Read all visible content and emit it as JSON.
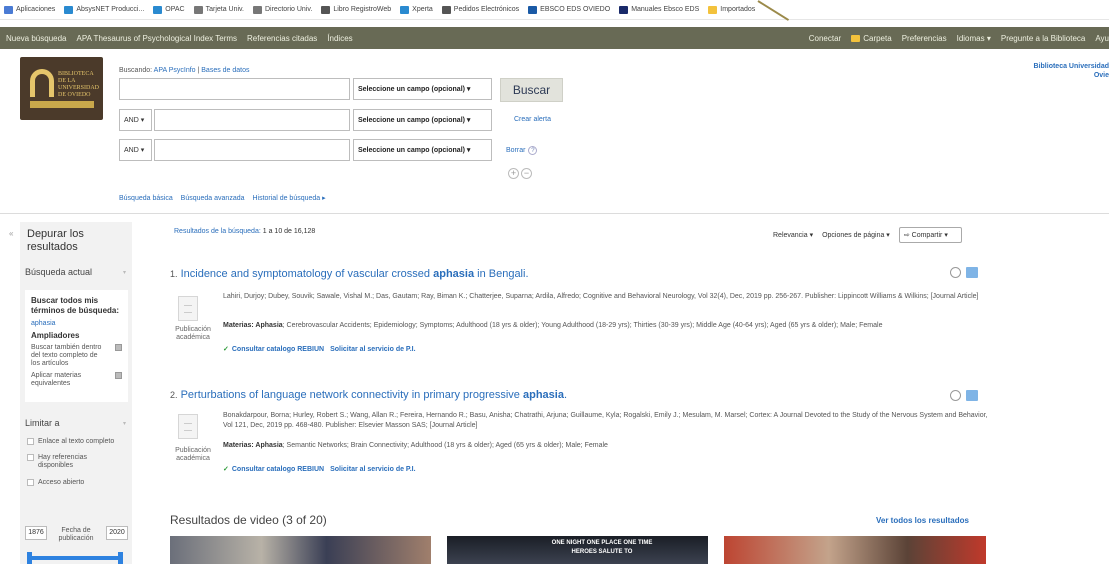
{
  "bookmarks": [
    {
      "label": "Aplicaciones",
      "icon": "apps-grid-icon",
      "color": "#4a7bd4"
    },
    {
      "label": "AbsysNET Producci...",
      "icon": "absysnet-icon",
      "color": "#2a8ad0"
    },
    {
      "label": "OPAC",
      "icon": "opac-icon",
      "color": "#2a8ad0"
    },
    {
      "label": "Tarjeta Univ.",
      "icon": "university-icon",
      "color": "#777"
    },
    {
      "label": "Directorio Univ.",
      "icon": "university-icon",
      "color": "#777"
    },
    {
      "label": "Libro RegistroWeb",
      "icon": "globe-icon",
      "color": "#555"
    },
    {
      "label": "Xperta",
      "icon": "xperta-icon",
      "color": "#2a8ad0"
    },
    {
      "label": "Pedidos Electrónicos",
      "icon": "globe-icon",
      "color": "#555"
    },
    {
      "label": "EBSCO EDS OVIEDO",
      "icon": "ebsco-icon",
      "color": "#1a5aa6"
    },
    {
      "label": "Manuales Ebsco EDS",
      "icon": "manual-icon",
      "color": "#1a2a6a"
    },
    {
      "label": "Importados",
      "icon": "folder-icon",
      "color": "#f3c23c"
    }
  ],
  "nav": {
    "left": [
      "Nueva búsqueda",
      "APA Thesaurus of Psychological Index Terms",
      "Referencias citadas",
      "Índices"
    ],
    "right": {
      "connect": "Conectar",
      "folder": "Carpeta",
      "prefs": "Preferencias",
      "lang": "Idiomas ▾",
      "ask": "Pregunte a la Biblioteca",
      "help": "Ayu"
    }
  },
  "logo": {
    "text": "BIBLIOTECA DE LA UNIVERSIDAD DE OVIEDO"
  },
  "search": {
    "searching_label": "Buscando:",
    "database": "APA PsycInfo",
    "databases_link": "Bases de datos",
    "field_placeholder": "Seleccione un campo (opcional) ▾",
    "operator": "AND ▾",
    "search_button": "Buscar",
    "create_alert": "Crear alerta",
    "clear": "Borrar",
    "links": [
      "Búsqueda básica",
      "Búsqueda avanzada",
      "Historial de búsqueda ▸"
    ]
  },
  "institution": {
    "line1": "Biblioteca Universidad",
    "line2": "Ovie"
  },
  "sidebar": {
    "title": "Depurar los resultados",
    "current": "Búsqueda actual",
    "find_all": "Buscar todos mis términos de búsqueda:",
    "term": "aphasia",
    "expanders": "Ampliadores",
    "opt1": "Buscar también dentro del texto completo de los artículos",
    "opt2": "Aplicar materias equivalentes",
    "limit": "Limitar a",
    "lim1": "Enlace al texto completo",
    "lim2": "Hay referencias disponibles",
    "lim3": "Acceso abierto",
    "year_from": "1876",
    "year_to": "2020",
    "date_label": "Fecha de publicación"
  },
  "results": {
    "count_prefix": "Resultados de la búsqueda:",
    "count": "1 a 10 de 16,128",
    "sort": "Relevancia ▾",
    "page_opts": "Opciones de página ▾",
    "share": "Compartir ▾",
    "items": [
      {
        "num": "1.",
        "title_pre": "Incidence and symptomatology of vascular crossed ",
        "title_bold": "aphasia",
        "title_post": " in Bengali.",
        "authors": "Lahiri, Durjoy; Dubey, Souvik; Sawale, Vishal M.; Das, Gautam; Ray, Biman K.; Chatterjee, Suparna; Ardila, Alfredo; Cognitive and Behavioral Neurology, Vol 32(4), Dec, 2019 pp. 256-267. Publisher: Lippincott Williams & Wilkins; [Journal Article]",
        "subjects_label": "Materias: Aphasia",
        "subjects": "; Cerebrovascular Accidents; Epidemiology; Symptoms; Adulthood (18 yrs & older); Young Adulthood (18-29 yrs); Thirties (30-39 yrs); Middle Age (40-64 yrs); Aged (65 yrs & older); Male; Female",
        "pubtype": "Publicación académica",
        "link1": "Consultar catalogo REBIUN",
        "link2": "Solicitar al servicio de P.I."
      },
      {
        "num": "2.",
        "title_pre": "Perturbations of language network connectivity in primary progressive ",
        "title_bold": "aphasia",
        "title_post": ".",
        "authors": "Bonakdarpour, Borna; Hurley, Robert S.; Wang, Allan R.; Fereira, Hernando R.; Basu, Anisha; Chatrathi, Arjuna; Guillaume, Kyla; Rogalski, Emily J.; Mesulam, M. Marsel; Cortex: A Journal Devoted to the Study of the Nervous System and Behavior, Vol 121, Dec, 2019 pp. 468-480. Publisher: Elsevier Masson SAS; [Journal Article]",
        "subjects_label": "Materias: Aphasia",
        "subjects": "; Semantic Networks; Brain Connectivity; Adulthood (18 yrs & older); Aged (65 yrs & older); Male; Female",
        "pubtype": "Publicación académica",
        "link1": "Consultar catalogo REBIUN",
        "link2": "Solicitar al servicio de P.I."
      }
    ]
  },
  "video": {
    "heading": "Resultados de video (3 of 20)",
    "see_all": "Ver todos los resultados",
    "thumb2_text": "ONE NIGHT ONE PLACE ONE TIME HEROES SALUTE TO"
  }
}
